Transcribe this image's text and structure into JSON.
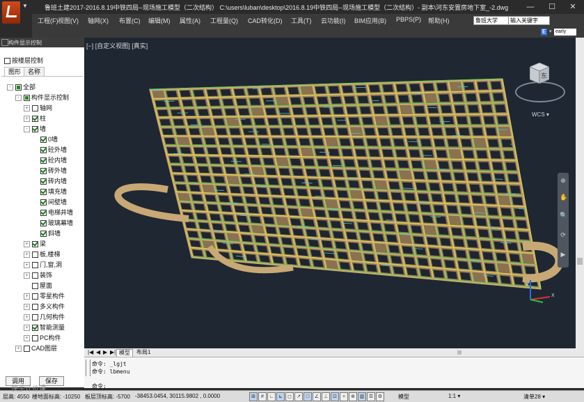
{
  "window": {
    "title": "鲁班土建2017-2016.8.19中铁四局--现场施工模型（二次结构）    C:\\users\\luban\\desktop\\2016.8.19中铁四局--现场施工模型（二次结构）- 副本\\河东安置房地下室_-2.dwg",
    "controls": [
      "—",
      "☐",
      "✕"
    ]
  },
  "menu": [
    "工程(F)",
    "视图(V)",
    "轴网(X)",
    "布置(C)",
    "编辑(M)",
    "属性(A)",
    "工程量(Q)",
    "CAD转化(D)",
    "工具(T)",
    "云功能(I)",
    "BIM应用(B)",
    "PBPS(P)",
    "帮助(H)"
  ],
  "search": {
    "selected": "鲁班大学",
    "placeholder": "输入关键字"
  },
  "account": {
    "badge": "E",
    "user": "early"
  },
  "left_panel": {
    "title": "构件显示控制",
    "floor_option": "按楼层控制",
    "tabs": [
      "图形",
      "名称"
    ],
    "tree": [
      {
        "label": "全部",
        "level": 0,
        "exp": "-",
        "check": "partial"
      },
      {
        "label": "构件显示控制",
        "level": 1,
        "exp": "-",
        "check": "partial"
      },
      {
        "label": "轴网",
        "level": 2,
        "exp": "+",
        "check": "off"
      },
      {
        "label": "柱",
        "level": 2,
        "exp": "+",
        "check": "on"
      },
      {
        "label": "墙",
        "level": 2,
        "exp": "-",
        "check": "on"
      },
      {
        "label": "0墙",
        "level": 3,
        "exp": "",
        "check": "on"
      },
      {
        "label": "砼外墙",
        "level": 3,
        "exp": "",
        "check": "on"
      },
      {
        "label": "砼内墙",
        "level": 3,
        "exp": "",
        "check": "on"
      },
      {
        "label": "砖外墙",
        "level": 3,
        "exp": "",
        "check": "on"
      },
      {
        "label": "砖内墙",
        "level": 3,
        "exp": "",
        "check": "on"
      },
      {
        "label": "填充墙",
        "level": 3,
        "exp": "",
        "check": "on"
      },
      {
        "label": "间壁墙",
        "level": 3,
        "exp": "",
        "check": "on"
      },
      {
        "label": "电梯井墙",
        "level": 3,
        "exp": "",
        "check": "on"
      },
      {
        "label": "玻璃幕墙",
        "level": 3,
        "exp": "",
        "check": "on"
      },
      {
        "label": "斜墙",
        "level": 3,
        "exp": "",
        "check": "on"
      },
      {
        "label": "梁",
        "level": 2,
        "exp": "+",
        "check": "on"
      },
      {
        "label": "板,楼梯",
        "level": 2,
        "exp": "+",
        "check": "off"
      },
      {
        "label": "门,窗,洞",
        "level": 2,
        "exp": "+",
        "check": "off"
      },
      {
        "label": "装饰",
        "level": 2,
        "exp": "+",
        "check": "off"
      },
      {
        "label": "屋面",
        "level": 2,
        "exp": "",
        "check": "off"
      },
      {
        "label": "零星构件",
        "level": 2,
        "exp": "+",
        "check": "off"
      },
      {
        "label": "多义构件",
        "level": 2,
        "exp": "+",
        "check": "off"
      },
      {
        "label": "几何构件",
        "level": 2,
        "exp": "+",
        "check": "off"
      },
      {
        "label": "智能测量",
        "level": 2,
        "exp": "+",
        "check": "on"
      },
      {
        "label": "PC构件",
        "level": 2,
        "exp": "+",
        "check": "off"
      },
      {
        "label": "CAD图层",
        "level": 1,
        "exp": "+",
        "check": "off"
      }
    ],
    "buttons": {
      "apply": "调用",
      "save": "保存"
    }
  },
  "viewport": {
    "label": "[−] [自定义视图] [真实]",
    "cube_face": "东",
    "wcs": "WCS ▾",
    "nav_icons": [
      "⊕",
      "✋",
      "🔍",
      "⟳",
      "▶"
    ]
  },
  "layout_tabs": {
    "arrows": [
      "|◀",
      "◀",
      "▶",
      "▶|"
    ],
    "model": "模型",
    "layout": "布局1"
  },
  "command": {
    "lines": [
      "命令: _lgjt",
      "命令: lbmenu",
      "",
      "命令:"
    ]
  },
  "status": {
    "floor": "层高: 4550",
    "bottom": "楼地面标高: -10250",
    "top": "板层顶标高: -5700",
    "coords": "-38453.0454,  30115.9802 , 0.0000",
    "model_label": "模型",
    "scale": "1:1 ▾",
    "clean": "清单28 ▾",
    "watermark": "快手计价课"
  },
  "colors": {
    "viewport_bg": "#1f2733",
    "wall_tan": "#c8a874",
    "beam_yellow": "#e8e23a",
    "beam_green": "#52d63c",
    "edge_cyan": "#49c6d8"
  }
}
